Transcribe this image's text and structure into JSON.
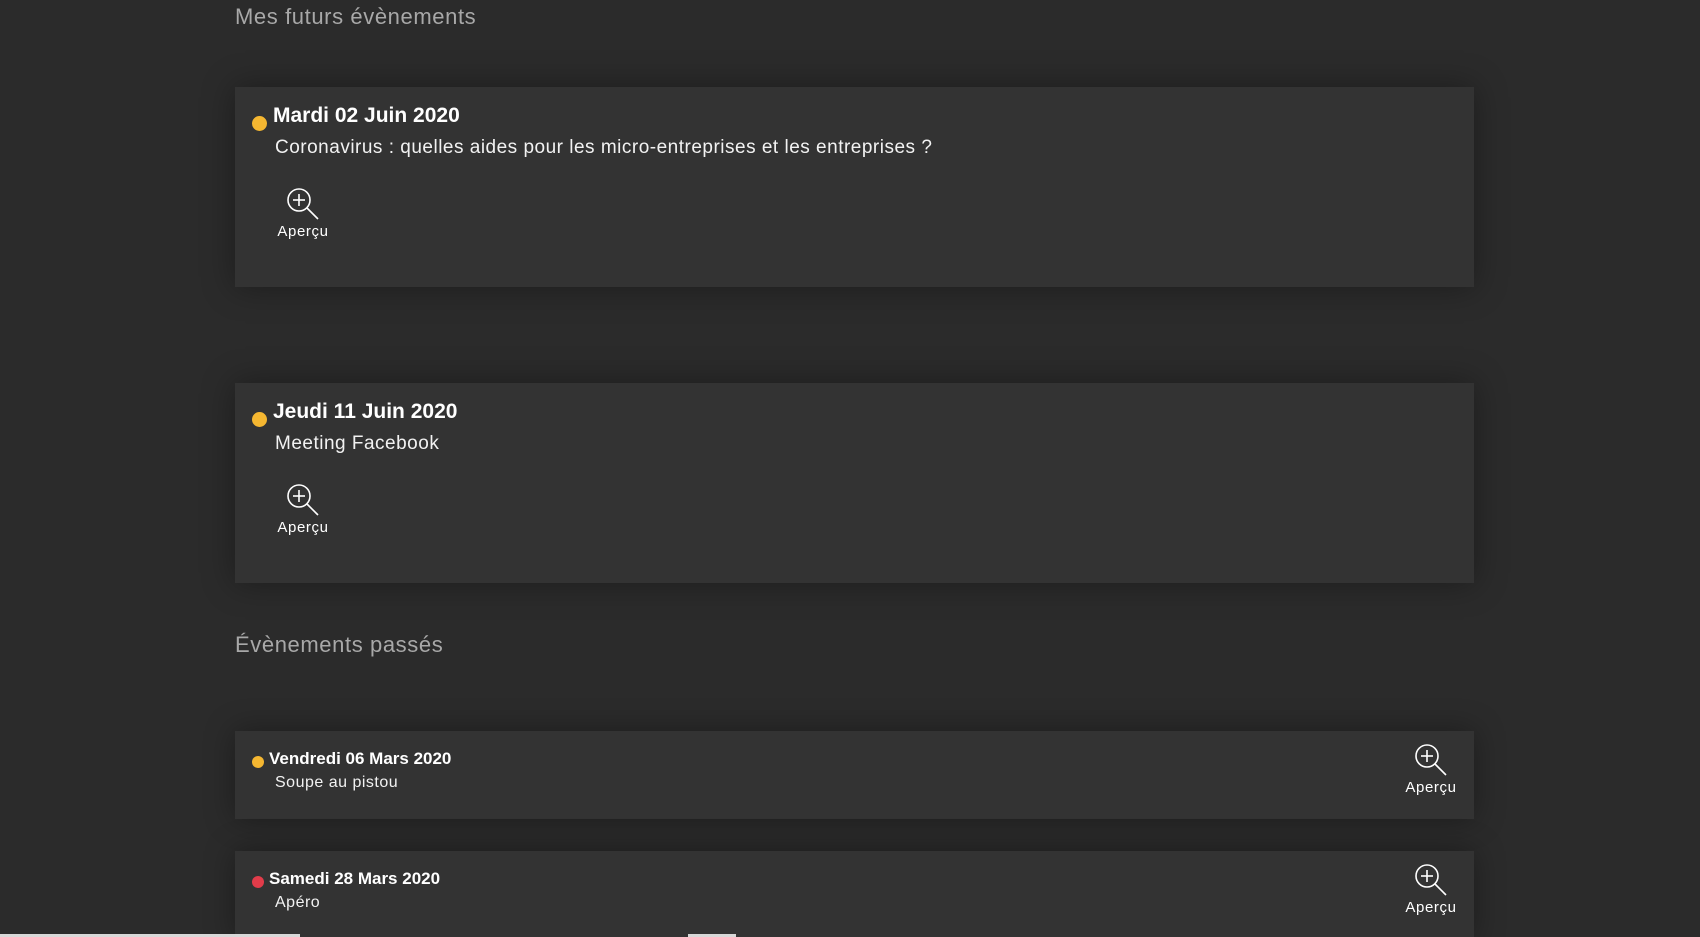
{
  "upcoming": {
    "heading": "Mes futurs évènements",
    "events": [
      {
        "date": "Mardi 02 Juin 2020",
        "title": "Coronavirus : quelles aides pour les micro-entreprises et les entreprises ?",
        "preview_label": "Aperçu",
        "status_color": "#f5b731"
      },
      {
        "date": "Jeudi 11 Juin 2020",
        "title": "Meeting Facebook",
        "preview_label": "Aperçu",
        "status_color": "#f5b731"
      }
    ]
  },
  "past": {
    "heading": "Évènements passés",
    "events": [
      {
        "date": "Vendredi 06 Mars 2020",
        "title": "Soupe au pistou",
        "preview_label": "Aperçu",
        "status_color": "#f5b731"
      },
      {
        "date": "Samedi 28 Mars 2020",
        "title": "Apéro",
        "preview_label": "Aperçu",
        "status_color": "#e23c4a"
      }
    ]
  },
  "icons": {
    "preview": "zoom-in-icon",
    "status": "status-dot"
  }
}
